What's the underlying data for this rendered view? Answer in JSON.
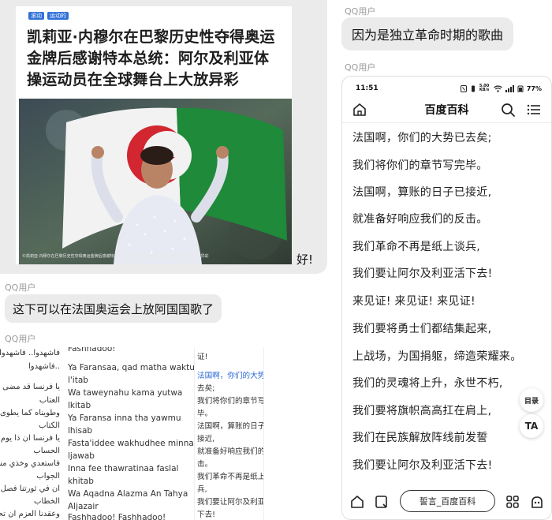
{
  "news": {
    "tags": [
      "滚动",
      "运动的"
    ],
    "title": "凯莉亚·内穆尔在巴黎历史性夺得奥运金牌后感谢特本总统：阿尔及利亚体操运动员在全球舞台上大放异彩",
    "caption": "©凯莉亚·内穆尔在巴黎历史性夺得奥运金牌后感谢特本总统：阿尔及利亚体操运动员在全球舞台上大放异彩",
    "reply": "好!"
  },
  "left_messages": [
    {
      "sender": "QQ用户",
      "text": "这下可以在法国奥运会上放阿国国歌了"
    },
    {
      "sender": "QQ用户"
    }
  ],
  "lyrics_image": {
    "arabic": [
      "فاشهدوا.. فاشهدوا",
      "..فاشهدوا",
      "يا فرنسا قد مضى وقت",
      "العتاب",
      "وطويناه كما يطوى",
      "الكتاب",
      "يا فرنسا ان ذا يوم",
      "الحساب",
      "فاستعدي وخذي منا",
      "الجواب",
      "ان في ثورتنا فصل",
      "الخطاب",
      "وعقدنا العزم ان تحيا"
    ],
    "latin": [
      "Fashhadoo!",
      "Ya Faransaa, qad matha waktu",
      "l'itab",
      "Wa taweynahu kama yutwa",
      "lkitab",
      "Ya Faransa inna tha yawmu",
      "lhisab",
      "Fasta'iddee wakhudhee minna",
      "ljawab",
      "Inna fee thawratinaa faslal",
      "khitab",
      "Wa Aqadna Alazma An Tahya",
      "Aljazair",
      "Fashhadoo! Fashhadoo!"
    ],
    "chinese": [
      "证!",
      "法国啊，你们的大势已",
      "去矣;",
      "我们将你们的章节写完",
      "毕。",
      "法国啊，算账的日子已",
      "接近,",
      "就准备好响应我们的反",
      "击。",
      "我们革命不再是纸上谈",
      "兵,",
      "我们要让阿尔及利亚活",
      "下去!"
    ]
  },
  "right_messages": [
    {
      "sender": "QQ用户",
      "text": "因为是独立革命时期的歌曲"
    },
    {
      "sender": "QQ用户"
    }
  ],
  "phone": {
    "time": "11:51",
    "status": "5.00 KB/s",
    "battery": "77%",
    "app_title": "百度百科",
    "lyrics": [
      "法国啊，你们的大势已去矣;",
      "我们将你们的章节写完毕。",
      "法国啊，算账的日子已接近,",
      "就准备好响应我们的反击。",
      "我们革命不再是纸上谈兵,",
      "我们要让阿尔及利亚活下去!",
      "来见证! 来见证! 来见证!",
      "我们要将勇士们都结集起来,",
      "上战场，为国捐躯，缔造荣耀来。",
      "我们的灵魂将上升，永世不朽,",
      "我们要将旗帜高高扛在肩上,",
      "我们在民族解放阵线前发誓",
      "我们要让阿尔及利亚活下去!"
    ],
    "float_toc": "目录",
    "float_ta": "TA",
    "bottom_input": "誓言_百度百科"
  }
}
